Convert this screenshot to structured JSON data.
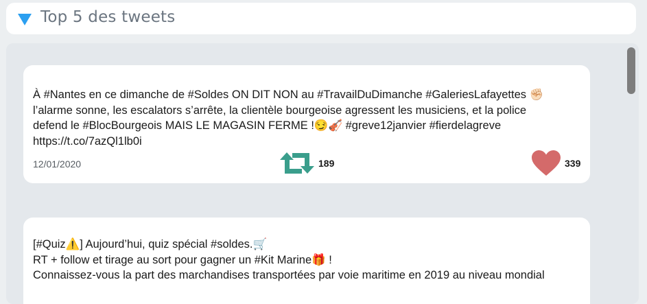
{
  "header": {
    "title": "Top 5 des tweets",
    "toggle_icon": "triangle-down-icon",
    "accent_color": "#2b9ff0"
  },
  "tweets": [
    {
      "text": "À #Nantes en ce dimanche de #Soldes ON DIT NON au #TravailDuDimanche #GaleriesLafayettes ✊🏻\nl’alarme sonne, les escalators s’arrête, la clientèle bourgeoise agressent les musiciens, et la police\ndefend le #BlocBourgeois MAIS LE MAGASIN FERME !😏🎻 #greve12janvier #fierdelagreve\nhttps://t.co/7azQl1lb0i",
      "date": "12/01/2020",
      "retweets": "189",
      "likes": "339"
    },
    {
      "text": "[#Quiz⚠️] Aujourd’hui, quiz spécial #soldes.🛒\nRT + follow et tirage au sort pour gagner un #Kit Marine🎁 !\nConnaissez-vous la part des marchandises transportées par voie maritime en 2019 au niveau mondial"
    }
  ],
  "colors": {
    "retweet": "#3a9e8c",
    "like": "#d46a6a"
  }
}
